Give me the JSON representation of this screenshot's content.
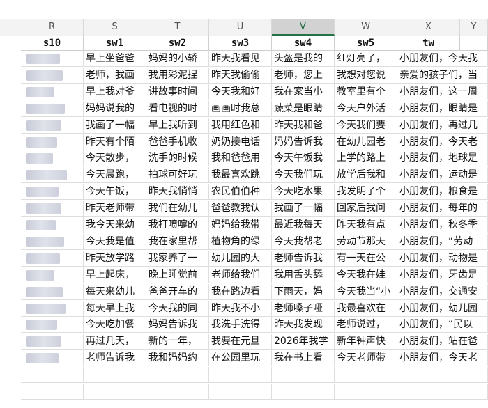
{
  "column_letters": [
    "R",
    "S",
    "T",
    "U",
    "V",
    "W",
    "X",
    "Y"
  ],
  "selected_column": "V",
  "headers": [
    "s10",
    "sw1",
    "sw2",
    "sw3",
    "sw4",
    "sw5",
    "tw"
  ],
  "rows": [
    [
      "早上坐爸爸",
      "妈妈的小轿",
      "昨天我看见",
      "头盔是我的",
      "红灯亮了，",
      "小朋友们，今天我"
    ],
    [
      "老师，我画",
      "我用彩泥捏",
      "昨天我偷偷",
      "老师，您上",
      "我想对您说",
      "亲爱的孩子们，当"
    ],
    [
      "早上我对爷",
      "讲故事时间",
      "今天我和好",
      "我在家当小",
      "教室里有个",
      "小朋友们，这一周"
    ],
    [
      "妈妈说我的",
      "看电视的时",
      "画画时我总",
      "蔬菜是眼睛",
      "今天户外活",
      "小朋友们，眼睛是"
    ],
    [
      "我画了一幅",
      "早上我听到",
      "我用红色和",
      "昨天我和爸",
      "今天我们要",
      "小朋友们，再过几"
    ],
    [
      "昨天有个陌",
      "爸爸手机收",
      "奶奶接电话",
      "妈妈告诉我",
      "在幼儿园老",
      "小朋友们，今天老"
    ],
    [
      "今天散步，",
      "洗手的时候",
      "我和爸爸用",
      "今天午饭我",
      "上学的路上",
      "小朋友们，地球是"
    ],
    [
      "今天晨跑，",
      "拍球可好玩",
      "我最喜欢跳",
      "今天我们玩",
      "放学后我和",
      "小朋友们，运动是"
    ],
    [
      "今天午饭，",
      "昨天我悄悄",
      "农民伯伯种",
      "今天吃水果",
      "我发明了个",
      "小朋友们，粮食是"
    ],
    [
      "昨天老师带",
      "我们在幼儿",
      "爸爸教我认",
      "我画了一幅",
      "回家后我问",
      "小朋友们，每年的"
    ],
    [
      "我今天来幼",
      "我打喷嚏的",
      "妈妈给我带",
      "最近我每天",
      "昨天我有点",
      "小朋友们，秋冬季"
    ],
    [
      "今天我是值",
      "我在家里帮",
      "植物角的绿",
      "今天我帮老",
      "劳动节那天",
      "小朋友们，“劳动"
    ],
    [
      "昨天放学路",
      "我家养了一",
      "幼儿园的大",
      "老师告诉我",
      "有一天在公",
      "小朋友们，动物是"
    ],
    [
      "早上起床，",
      "晚上睡觉前",
      "老师给我们",
      "我用舌头舔",
      "今天我在娃",
      "小朋友们，牙齿是"
    ],
    [
      "每天来幼儿",
      "爸爸开车的",
      "我在路边看",
      "下雨天，妈",
      "今天我当“小",
      "小朋友们，交通安"
    ],
    [
      "每天早上我",
      "今天我的同",
      "昨天我不小",
      "老师嗓子哑",
      "我最喜欢在",
      "小朋友们，幼儿园"
    ],
    [
      "今天吃加餐",
      "妈妈告诉我",
      "我洗手洗得",
      "昨天我发现",
      "老师说过，",
      "小朋友们，“民以"
    ],
    [
      "再过几天，",
      "新的一年，",
      "我要在元旦",
      "2026年我学",
      "新年钟声快",
      "小朋友们，站在爸"
    ],
    [
      "老师告诉我",
      "我和妈妈约",
      "在公园里玩",
      "我在书上看",
      "今天老师带",
      "小朋友们，今天老"
    ]
  ]
}
